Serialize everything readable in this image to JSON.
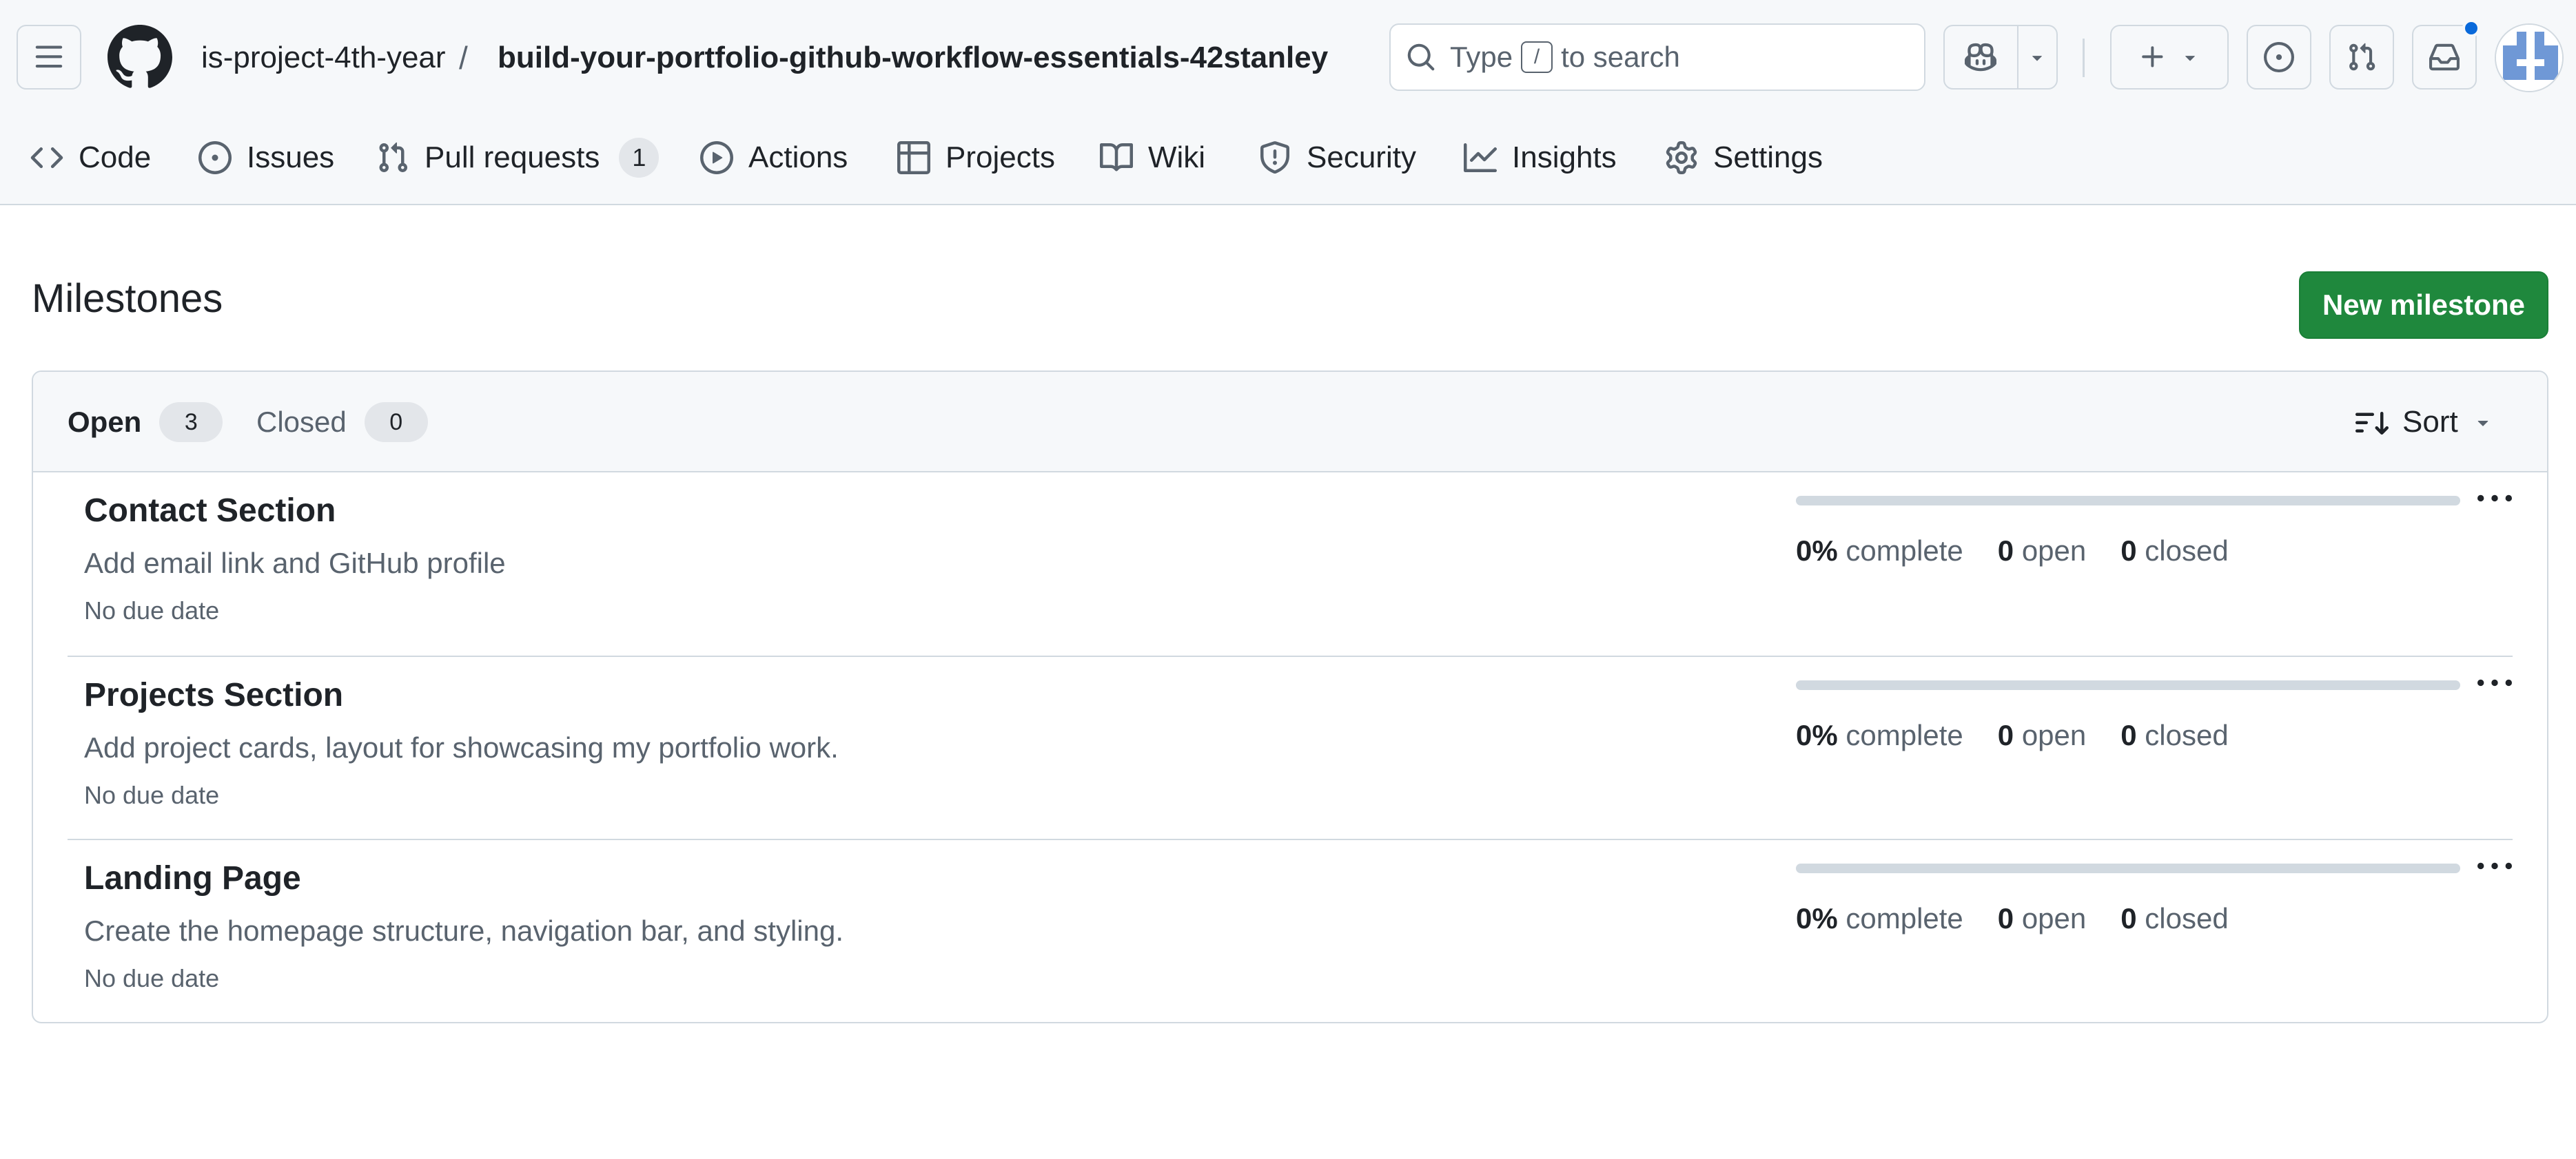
{
  "header": {
    "owner": "is-project-4th-year",
    "separator": "/",
    "repo": "build-your-portfolio-github-workflow-essentials-42stanley",
    "search": {
      "prefix": "Type",
      "key": "/",
      "suffix": "to search"
    }
  },
  "nav": {
    "tabs": [
      {
        "label": "Code",
        "icon": "code-icon"
      },
      {
        "label": "Issues",
        "icon": "issue-opened-icon"
      },
      {
        "label": "Pull requests",
        "icon": "git-pull-request-icon",
        "count": "1"
      },
      {
        "label": "Actions",
        "icon": "play-icon"
      },
      {
        "label": "Projects",
        "icon": "table-icon"
      },
      {
        "label": "Wiki",
        "icon": "book-icon"
      },
      {
        "label": "Security",
        "icon": "shield-icon"
      },
      {
        "label": "Insights",
        "icon": "graph-icon"
      },
      {
        "label": "Settings",
        "icon": "gear-icon"
      }
    ]
  },
  "page": {
    "title": "Milestones",
    "new_button": "New milestone"
  },
  "filters": {
    "open_label": "Open",
    "open_count": "3",
    "closed_label": "Closed",
    "closed_count": "0",
    "sort_label": "Sort"
  },
  "milestones": [
    {
      "title": "Contact Section",
      "description": "Add email link and GitHub profile",
      "due": "No due date",
      "progress_percent": 0,
      "percent": "0%",
      "complete_label": "complete",
      "open": "0",
      "open_label": "open",
      "closed": "0",
      "closed_label": "closed"
    },
    {
      "title": "Projects Section",
      "description": "Add project cards, layout for showcasing my portfolio work.",
      "due": "No due date",
      "progress_percent": 0,
      "percent": "0%",
      "complete_label": "complete",
      "open": "0",
      "open_label": "open",
      "closed": "0",
      "closed_label": "closed"
    },
    {
      "title": "Landing Page",
      "description": "Create the homepage structure, navigation bar, and styling.",
      "due": "No due date",
      "progress_percent": 0,
      "percent": "0%",
      "complete_label": "complete",
      "open": "0",
      "open_label": "open",
      "closed": "0",
      "closed_label": "closed"
    }
  ],
  "colors": {
    "accent_green": "#1f883d",
    "notification_blue": "#0969da",
    "muted_text": "#59636e",
    "border": "#d1d9e0"
  }
}
